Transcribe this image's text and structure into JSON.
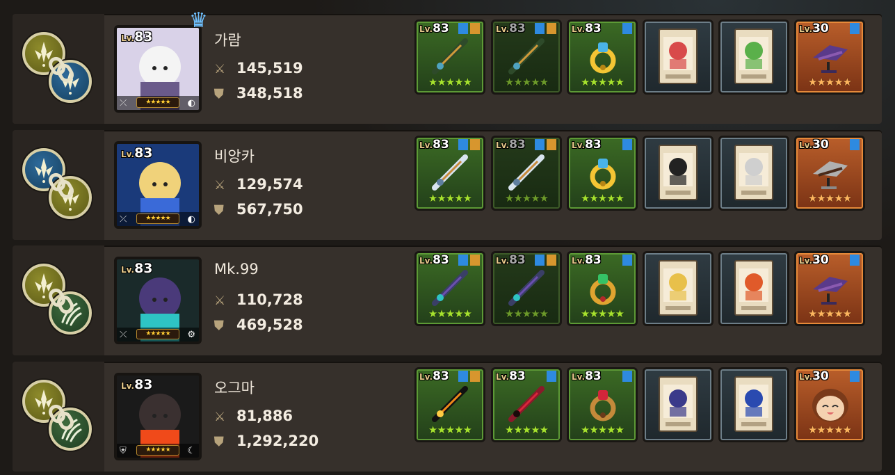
{
  "rows": [
    {
      "name": "가람",
      "level": "83",
      "attack": "145,519",
      "defense": "348,518",
      "link": {
        "a": "gold",
        "b": "blue"
      },
      "has_crown": true,
      "element_icon": "water-drop-icon",
      "class_icon": "bow-icon",
      "slots": [
        {
          "type": "weapon",
          "level": "83",
          "frame": "green",
          "badges": [
            "blue",
            "gold"
          ],
          "item_icon": "dragon-bow-icon"
        },
        {
          "type": "weapon",
          "level": "83",
          "frame": "dim",
          "badges": [
            "blue",
            "gold"
          ],
          "item_icon": "dragon-bow-icon"
        },
        {
          "type": "accessory",
          "level": "83",
          "frame": "green",
          "badges": [
            "blue"
          ],
          "item_icon": "gold-ring-icon"
        },
        {
          "type": "card",
          "frame": "card",
          "item_icon": "hero-card-icon"
        },
        {
          "type": "card",
          "frame": "card",
          "item_icon": "sword-card-icon"
        },
        {
          "type": "merch",
          "level": "30",
          "frame": "orange",
          "badges": [
            "blue"
          ],
          "item_icon": "dragon-figure-icon"
        }
      ]
    },
    {
      "name": "비앙카",
      "level": "83",
      "attack": "129,574",
      "defense": "567,750",
      "link": {
        "a": "blue",
        "b": "gold"
      },
      "has_crown": false,
      "element_icon": "water-drop-icon",
      "class_icon": "bow-icon",
      "slots": [
        {
          "type": "weapon",
          "level": "83",
          "frame": "green",
          "badges": [
            "blue",
            "gold"
          ],
          "item_icon": "spear-icon"
        },
        {
          "type": "weapon",
          "level": "83",
          "frame": "dim",
          "badges": [
            "blue",
            "gold"
          ],
          "item_icon": "spear-icon"
        },
        {
          "type": "accessory",
          "level": "83",
          "frame": "green",
          "badges": [
            "blue"
          ],
          "item_icon": "gold-ring-icon"
        },
        {
          "type": "card",
          "frame": "card",
          "item_icon": "hat-card-icon"
        },
        {
          "type": "card",
          "frame": "card",
          "item_icon": "elder-card-icon"
        },
        {
          "type": "merch",
          "level": "30",
          "frame": "orange",
          "badges": [
            "blue"
          ],
          "item_icon": "twin-figure-icon"
        }
      ]
    },
    {
      "name": "Mk.99",
      "level": "83",
      "attack": "110,728",
      "defense": "469,528",
      "link": {
        "a": "gold",
        "b": "green"
      },
      "has_crown": false,
      "element_icon": "gear-icon",
      "class_icon": "bow-icon",
      "slots": [
        {
          "type": "weapon",
          "level": "83",
          "frame": "green",
          "badges": [
            "blue",
            "gold"
          ],
          "item_icon": "cannon-icon"
        },
        {
          "type": "weapon",
          "level": "83",
          "frame": "dim",
          "badges": [
            "blue",
            "gold"
          ],
          "item_icon": "cannon-icon"
        },
        {
          "type": "accessory",
          "level": "83",
          "frame": "green",
          "badges": [
            "blue"
          ],
          "item_icon": "emerald-amulet-icon"
        },
        {
          "type": "card",
          "frame": "card",
          "item_icon": "lady-card-icon"
        },
        {
          "type": "card",
          "frame": "card",
          "item_icon": "food-card-icon"
        },
        {
          "type": "merch",
          "level": "30",
          "frame": "orange",
          "badges": [
            "blue"
          ],
          "item_icon": "dragon-figure-icon"
        }
      ]
    },
    {
      "name": "오그마",
      "level": "83",
      "attack": "81,886",
      "defense": "1,292,220",
      "link": {
        "a": "gold",
        "b": "green"
      },
      "has_crown": false,
      "element_icon": "moon-icon",
      "class_icon": "shield-icon",
      "slots": [
        {
          "type": "weapon",
          "level": "83",
          "frame": "green",
          "badges": [
            "blue",
            "gold"
          ],
          "item_icon": "flame-sword-icon"
        },
        {
          "type": "shield",
          "level": "83",
          "frame": "green",
          "badges": [
            "blue"
          ],
          "item_icon": "demon-shield-icon"
        },
        {
          "type": "accessory",
          "level": "83",
          "frame": "green",
          "badges": [
            "blue"
          ],
          "item_icon": "ruby-amulet-icon"
        },
        {
          "type": "card",
          "frame": "card",
          "item_icon": "demon-card-icon"
        },
        {
          "type": "card",
          "frame": "card",
          "item_icon": "warrior-card-icon"
        },
        {
          "type": "merch",
          "level": "30",
          "frame": "orange",
          "badges": [
            "blue"
          ],
          "item_icon": "smile-face-icon"
        }
      ]
    }
  ],
  "lv_prefix": "Lv.",
  "stars": "★★★★★",
  "icons": {
    "attack": "crossed-swords-icon",
    "defense": "shield-icon",
    "crown": "crown-icon"
  },
  "colors": {
    "gold_orb": "#8e8b2b",
    "blue_orb": "#2e6a9a",
    "green_orb": "#3e6b3d",
    "slot_green": "#3b6a24",
    "slot_orange": "#b95e2a",
    "crown": "#6ec0ff"
  }
}
